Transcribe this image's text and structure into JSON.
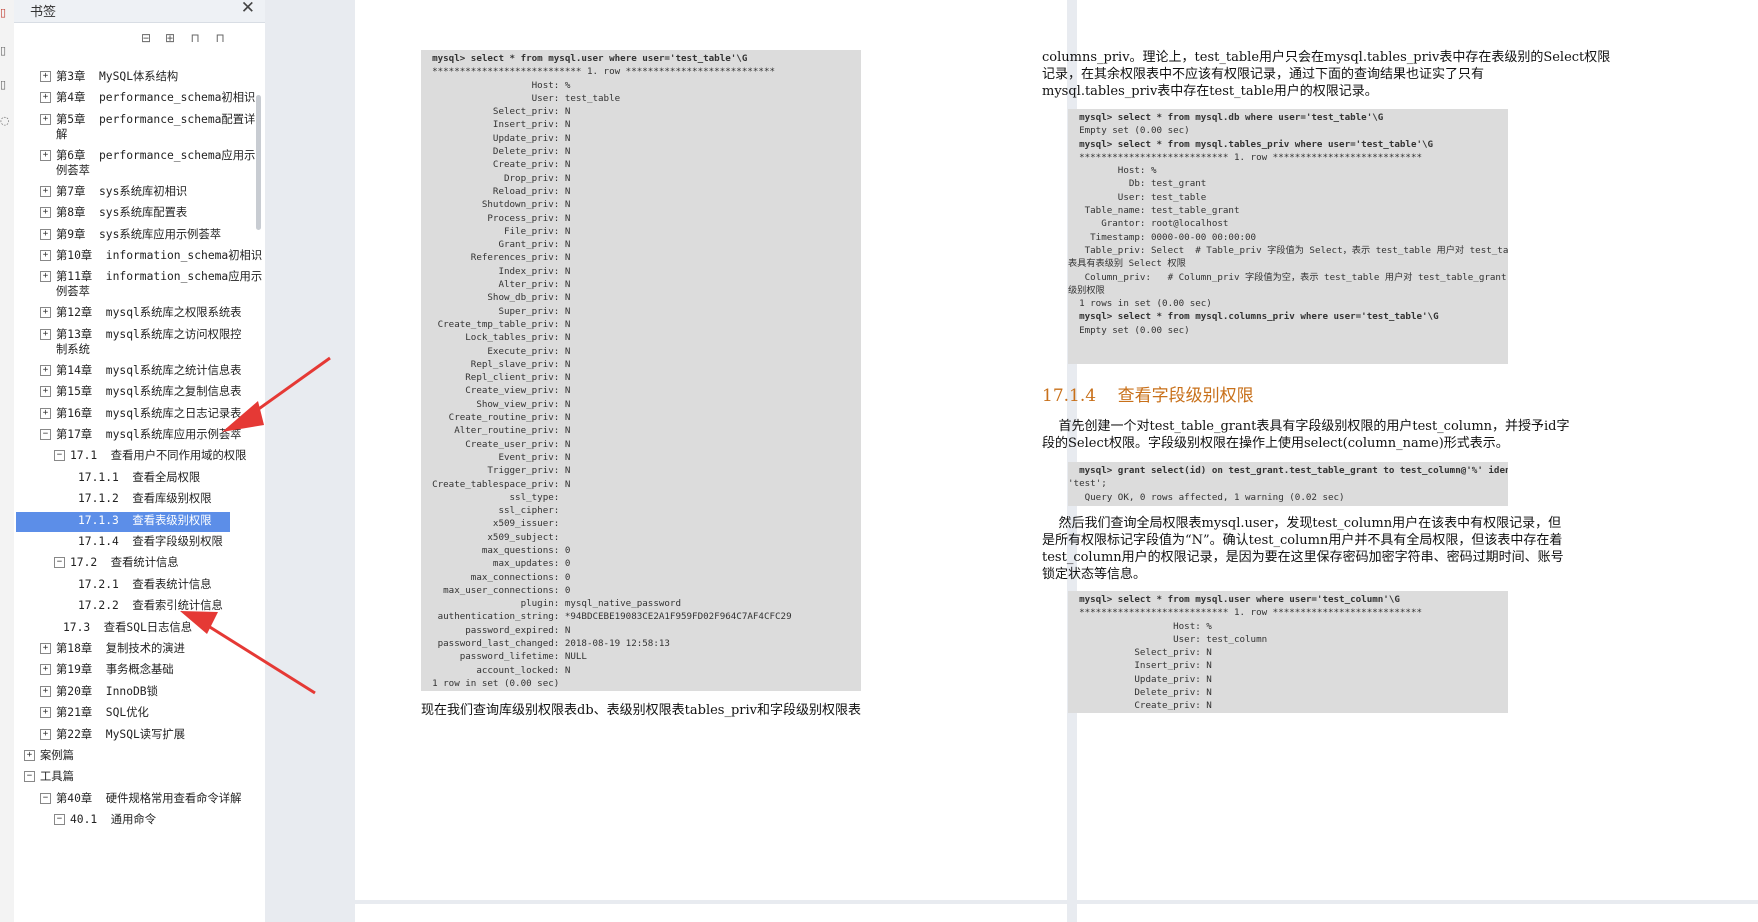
{
  "sidebar": {
    "title": "书签",
    "close_icon": "close-icon",
    "toolbar": [
      {
        "name": "collapse-all-icon",
        "glyph": "⊟"
      },
      {
        "name": "expand-all-icon",
        "glyph": "⊞"
      },
      {
        "name": "bookmark-add-icon",
        "glyph": "⊓"
      },
      {
        "name": "bookmark-icon",
        "glyph": "⊓"
      }
    ],
    "tree": [
      {
        "label": "第3章  MySQL体系结构",
        "exp": "+"
      },
      {
        "label": "第4章  performance_schema初相识",
        "exp": "+"
      },
      {
        "label": "第5章  performance_schema配置详",
        "label2": "解",
        "exp": "+"
      },
      {
        "label": "第6章  performance_schema应用示",
        "label2": "例荟萃",
        "exp": "+"
      },
      {
        "label": "第7章  sys系统库初相识",
        "exp": "+"
      },
      {
        "label": "第8章  sys系统库配置表",
        "exp": "+"
      },
      {
        "label": "第9章  sys系统库应用示例荟萃",
        "exp": "+"
      },
      {
        "label": "第10章  information_schema初相识",
        "exp": "+"
      },
      {
        "label": "第11章  information_schema应用示",
        "label2": "例荟萃",
        "exp": "+"
      },
      {
        "label": "第12章  mysql系统库之权限系统表",
        "exp": "+"
      },
      {
        "label": "第13章  mysql系统库之访问权限控",
        "label2": "制系统",
        "exp": "+"
      },
      {
        "label": "第14章  mysql系统库之统计信息表",
        "exp": "+"
      },
      {
        "label": "第15章  mysql系统库之复制信息表",
        "exp": "+"
      },
      {
        "label": "第16章  mysql系统库之日志记录表",
        "exp": "+"
      },
      {
        "label": "第17章  mysql系统库应用示例荟萃",
        "exp": "−"
      },
      {
        "label": "17.1  查看用户不同作用域的权限",
        "exp": "−",
        "level": 2
      },
      {
        "label": "17.1.1  查看全局权限",
        "level": 3
      },
      {
        "label": "17.1.2  查看库级别权限",
        "level": 3
      },
      {
        "label": "17.1.3  查看表级别权限",
        "level": 3,
        "selected": true
      },
      {
        "label": "17.1.4  查看字段级别权限",
        "level": 3
      },
      {
        "label": "17.2  查看统计信息",
        "exp": "−",
        "level": 2
      },
      {
        "label": "17.2.1  查看表统计信息",
        "level": 3
      },
      {
        "label": "17.2.2  查看索引统计信息",
        "level": 3
      },
      {
        "label": "17.3  查看SQL日志信息",
        "level": 22
      },
      {
        "label": "第18章  复制技术的演进",
        "exp": "+"
      },
      {
        "label": "第19章  事务概念基础",
        "exp": "+"
      },
      {
        "label": "第20章  InnoDB锁",
        "exp": "+"
      },
      {
        "label": "第21章  SQL优化",
        "exp": "+"
      },
      {
        "label": "第22章  MySQL读写扩展",
        "exp": "+"
      },
      {
        "label": "案例篇",
        "exp": "+",
        "level": 0
      },
      {
        "label": "工具篇",
        "exp": "−",
        "level": 0
      },
      {
        "label": "第40章  硬件规格常用查看命令详解",
        "exp": "−"
      },
      {
        "label": "40.1  通用命令",
        "exp": "−",
        "level": 2
      }
    ]
  },
  "left_page": {
    "code_lines": [
      "  mysql> select * from mysql.user where user='test_table'\\G",
      "  *************************** 1. row ***************************",
      "                    Host: %",
      "                    User: test_table",
      "             Select_priv: N",
      "             Insert_priv: N",
      "             Update_priv: N",
      "             Delete_priv: N",
      "             Create_priv: N",
      "               Drop_priv: N",
      "             Reload_priv: N",
      "           Shutdown_priv: N",
      "            Process_priv: N",
      "               File_priv: N",
      "              Grant_priv: N",
      "         References_priv: N",
      "              Index_priv: N",
      "              Alter_priv: N",
      "            Show_db_priv: N",
      "              Super_priv: N",
      "   Create_tmp_table_priv: N",
      "        Lock_tables_priv: N",
      "            Execute_priv: N",
      "         Repl_slave_priv: N",
      "        Repl_client_priv: N",
      "        Create_view_priv: N",
      "          Show_view_priv: N",
      "     Create_routine_priv: N",
      "      Alter_routine_priv: N",
      "        Create_user_priv: N",
      "              Event_priv: N",
      "            Trigger_priv: N",
      "  Create_tablespace_priv: N",
      "                ssl_type:",
      "              ssl_cipher:",
      "             x509_issuer:",
      "            x509_subject:",
      "           max_questions: 0",
      "             max_updates: 0",
      "         max_connections: 0",
      "    max_user_connections: 0",
      "                  plugin: mysql_native_password",
      "   authentication_string: *94BDCEBE19083CE2A1F959FD02F964C7AF4CFC29",
      "        password_expired: N",
      "   password_last_changed: 2018-08-19 12:58:13",
      "       password_lifetime: NULL",
      "          account_locked: N",
      "  1 row in set (0.00 sec)"
    ],
    "caption": "现在我们查询库级别权限表db、表级别权限表tables_priv和字段级别权限表"
  },
  "right_page": {
    "para1": [
      "columns_priv。理论上，test_table用户只会在mysql.tables_priv表中存在表级别的Select权限",
      "记录，在其余权限表中不应该有权限记录，通过下面的查询结果也证实了只有",
      "mysql.tables_priv表中存在test_table用户的权限记录。"
    ],
    "code1": [
      "  mysql> select * from mysql.db where user='test_table'\\G",
      "  Empty set (0.00 sec)",
      "",
      "  mysql> select * from mysql.tables_priv where user='test_table'\\G",
      "  *************************** 1. row ***************************",
      "         Host: %",
      "           Db: test_grant",
      "         User: test_table",
      "   Table_name: test_table_grant",
      "      Grantor: root@localhost",
      "    Timestamp: 0000-00-00 00:00:00",
      "   Table_priv: Select  # Table_priv 字段值为 Select，表示 test_table 用户对 test_table_grant",
      "表具有表级别 Select 权限",
      "   Column_priv:   # Column_priv 字段值为空，表示 test_table 用户对 test_table_grant 表不具有字段",
      "级别权限",
      "  1 rows in set (0.00 sec)",
      "",
      "  mysql> select * from mysql.columns_priv where user='test_table'\\G",
      "  Empty set (0.00 sec)"
    ],
    "heading": "17.1.4    查看字段级别权限",
    "para2": [
      "    首先创建一个对test_table_grant表具有字段级别权限的用户test_column，并授予id字",
      "段的Select权限。字段级别权限在操作上使用select(column_name)形式表示。"
    ],
    "code2": [
      "  mysql> grant select(id) on test_grant.test_table_grant to test_column@'%' identified by",
      "'test';",
      "   Query OK, 0 rows affected, 1 warning (0.02 sec)"
    ],
    "para3": [
      "    然后我们查询全局权限表mysql.user，发现test_column用户在该表中有权限记录，但",
      "是所有权限标记字段值为“N”。确认test_column用户并不具有全局权限，但该表中存在着",
      "test_column用户的权限记录，是因为要在这里保存密码加密字符串、密码过期时间、账号",
      "锁定状态等信息。"
    ],
    "code3": [
      "  mysql> select * from mysql.user where user='test_column'\\G",
      "  *************************** 1. row ***************************",
      "                   Host: %",
      "                   User: test_column",
      "            Select_priv: N",
      "            Insert_priv: N",
      "            Update_priv: N",
      "            Delete_priv: N",
      "            Create_priv: N"
    ]
  },
  "colors": {
    "selected": "#5c8ee8",
    "heading": "#c8701a",
    "arrow": "#e53935",
    "code_bg": "#dcdcdc"
  }
}
